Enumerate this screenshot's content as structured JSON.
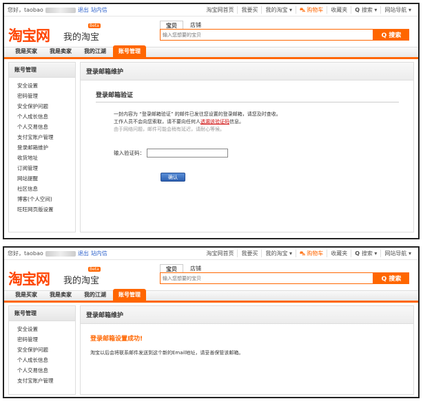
{
  "colors": {
    "accent": "#ff6600",
    "link": "#3366cc",
    "success": "#ff6600"
  },
  "topbar": {
    "greeting": "您好，taobao",
    "logout": "退出",
    "inbox": "站内信",
    "links": [
      "淘宝网首页",
      "我要买",
      "我的淘宝 ▾",
      "购物车",
      "收藏夹",
      "搜索 ▾",
      "网站导航 ▾"
    ]
  },
  "header": {
    "logo": "淘宝网",
    "logo_sub": "我的淘宝",
    "beta": "Beta",
    "search_tabs": [
      "宝贝",
      "店铺"
    ],
    "search_placeholder": "输入您想要的宝贝",
    "search_button": "Q 搜索"
  },
  "nav": [
    "我是买家",
    "我是卖家",
    "我的江湖",
    "账号管理"
  ],
  "screen1": {
    "sidebar_title": "账号管理",
    "sidebar_items": [
      "安全设置",
      "密码管理",
      "安全保护问题",
      "个人成长信息",
      "个人交易信息",
      "支付宝账户管理",
      "登录邮箱维护",
      "收货地址",
      "订阅管理",
      "网站提醒",
      "社区信息",
      "博客(个人空间)",
      "旺旺网页版设置"
    ],
    "main_title": "登录邮箱维护",
    "section_title": "登录邮箱验证",
    "line1": "一封内容为 “登录邮箱验证” 的邮件已发往您设置的登录邮箱，请您及时查收。",
    "line2a": "工作人员不会向您索取，请不要向任何人",
    "line2b": "透漏该验证码",
    "line2c": "信息。",
    "line3": "由于网络问题，邮件可能会稍有延迟，请耐心等候。",
    "code_label": "输入验证码：",
    "confirm_button": "确认"
  },
  "screen2": {
    "sidebar_title": "账号管理",
    "sidebar_items": [
      "安全设置",
      "密码管理",
      "安全保护问题",
      "个人成长信息",
      "个人交易信息",
      "支付宝账户管理"
    ],
    "main_title": "登录邮箱维护",
    "success_title": "登录邮箱设置成功!",
    "success_msg": "淘宝以后会将联系邮件发送到这个新的Email地址，请妥善保管该邮箱。"
  }
}
